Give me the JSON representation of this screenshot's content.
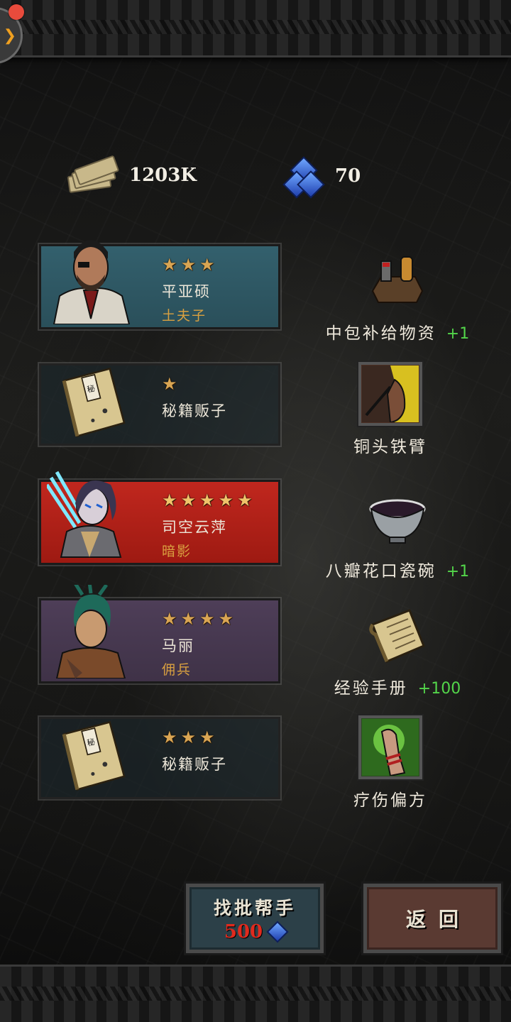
{
  "currency": {
    "money": "1203K",
    "gems": "70"
  },
  "cards": [
    {
      "stars": 3,
      "name": "平亚硕",
      "class": "土夫子",
      "style": "teal"
    },
    {
      "stars": 1,
      "name": "秘籍贩子",
      "class": "",
      "style": "dark"
    },
    {
      "stars": 5,
      "name": "司空云萍",
      "class": "暗影",
      "style": "red"
    },
    {
      "stars": 4,
      "name": "马丽",
      "class": "佣兵",
      "style": "purple"
    },
    {
      "stars": 3,
      "name": "秘籍贩子",
      "class": "",
      "style": "dark"
    }
  ],
  "rewards": [
    {
      "name": "中包补给物资",
      "count": "+1",
      "icon": "supply-pack-icon"
    },
    {
      "name": "铜头铁臂",
      "count": "",
      "icon": "skill-iron-arm-icon"
    },
    {
      "name": "八瓣花口瓷碗",
      "count": "+1",
      "icon": "porcelain-bowl-icon"
    },
    {
      "name": "经验手册",
      "count": "+100",
      "icon": "exp-manual-icon"
    },
    {
      "name": "疗伤偏方",
      "count": "",
      "icon": "healing-remedy-icon"
    }
  ],
  "buttons": {
    "find_helper": "找批帮手",
    "find_cost": "500",
    "back": "返回"
  },
  "colors": {
    "card_teal": "#33606d",
    "card_red": "#c0271e",
    "card_purple": "#4e3e58",
    "star": "#d9a553",
    "class_text": "#d9a040",
    "reward_count": "#53d54a",
    "cost_text": "#e02a1e"
  }
}
